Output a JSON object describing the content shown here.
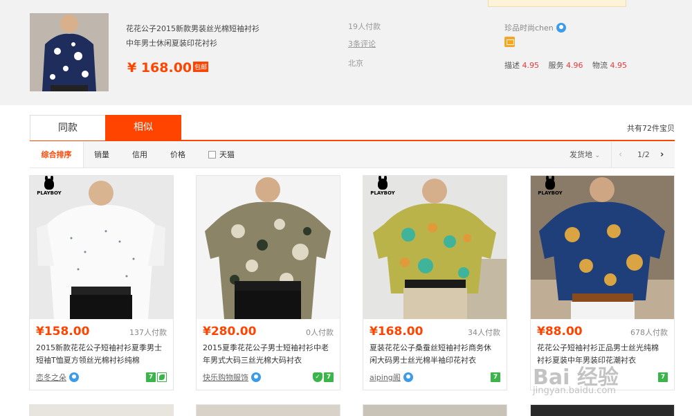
{
  "top_product": {
    "title_line1": "花花公子2015新款男装丝光棉短袖衬衫",
    "title_line2": "中年男士休闲夏装印花衬衫",
    "price": "¥ 168.00",
    "badge": "包邮",
    "sales": "19人付款",
    "reviews": "3条评论",
    "location": "北京",
    "shop": "珍品时尚chen",
    "scores": {
      "desc_label": "描述",
      "desc": "4.95",
      "service_label": "服务",
      "service": "4.96",
      "logistics_label": "物流",
      "logistics": "4.95"
    }
  },
  "tabs": {
    "same": "同款",
    "similar": "相似",
    "total": "共有72件宝贝"
  },
  "sortbar": {
    "default": "综合排序",
    "sales": "销量",
    "credit": "信用",
    "price": "价格",
    "tmall": "天猫",
    "ship_from": "发货地",
    "page": "1/2"
  },
  "products": [
    {
      "price": "¥158.00",
      "sales": "137人付款",
      "title_line1": "2015新款花花公子短袖衬衫夏季男士",
      "title_line2": "短袖T恤夏方领丝光棉衬衫纯棉",
      "shop": "恋冬之朵",
      "logo_text": "PLAYBOY"
    },
    {
      "price": "¥280.00",
      "sales": "0人付款",
      "title_line1": "2015夏季花花公子男士短袖衬衫中老",
      "title_line2": "年男式大码三丝光棉大码衬衣",
      "shop": "快乐购物服饰",
      "logo_text": ""
    },
    {
      "price": "¥168.00",
      "sales": "34人付款",
      "title_line1": "夏装花花公子桑蚕丝短袖衬衫商务休",
      "title_line2": "闲大码男士丝光棉半袖印花衬衣",
      "shop": "aiping阁",
      "logo_text": "PLAYBOY"
    },
    {
      "price": "¥88.00",
      "sales": "678人付款",
      "title_line1": "花花公子短袖衬衫正品男士丝光纯棉",
      "title_line2": "衬衫夏装中年男装印花潮衬衣",
      "shop": "",
      "logo_text": "PLAYBOY"
    }
  ],
  "watermark": {
    "line1": "Bai 经验",
    "line2": "jingyan.baidu.com"
  },
  "colors": {
    "accent": "#ff4400",
    "green_badge": "#3bb54a",
    "wangwang": "#3d9be9"
  }
}
